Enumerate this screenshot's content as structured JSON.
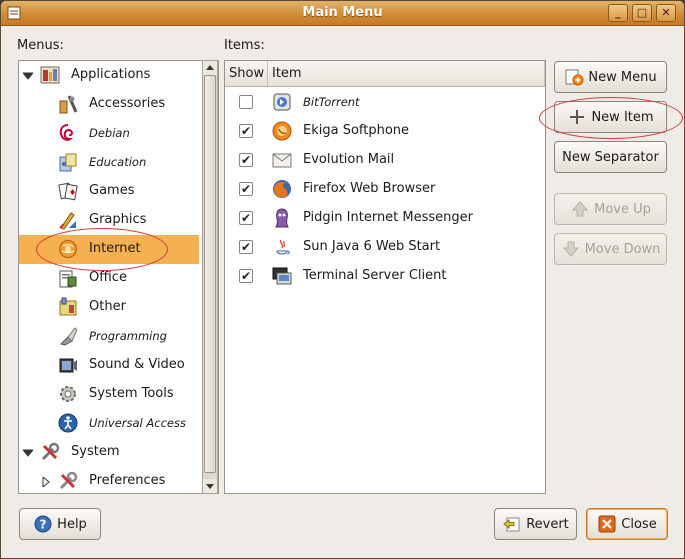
{
  "window": {
    "title": "Main Menu"
  },
  "labels": {
    "menus": "Menus:",
    "items": "Items:"
  },
  "menus": [
    {
      "label": "Applications",
      "level": 0,
      "expander": "expanded",
      "icon": "applications-icon",
      "italic": false,
      "selected": false
    },
    {
      "label": "Accessories",
      "level": 1,
      "icon": "accessories-icon",
      "italic": false,
      "selected": false
    },
    {
      "label": "Debian",
      "level": 1,
      "icon": "debian-icon",
      "italic": true,
      "selected": false
    },
    {
      "label": "Education",
      "level": 1,
      "icon": "education-icon",
      "italic": true,
      "selected": false
    },
    {
      "label": "Games",
      "level": 1,
      "icon": "games-icon",
      "italic": false,
      "selected": false
    },
    {
      "label": "Graphics",
      "level": 1,
      "icon": "graphics-icon",
      "italic": false,
      "selected": false
    },
    {
      "label": "Internet",
      "level": 1,
      "icon": "internet-icon",
      "italic": false,
      "selected": true
    },
    {
      "label": "Office",
      "level": 1,
      "icon": "office-icon",
      "italic": false,
      "selected": false
    },
    {
      "label": "Other",
      "level": 1,
      "icon": "other-icon",
      "italic": false,
      "selected": false
    },
    {
      "label": "Programming",
      "level": 1,
      "icon": "programming-icon",
      "italic": true,
      "selected": false
    },
    {
      "label": "Sound & Video",
      "level": 1,
      "icon": "sound-video-icon",
      "italic": false,
      "selected": false
    },
    {
      "label": "System Tools",
      "level": 1,
      "icon": "system-tools-icon",
      "italic": false,
      "selected": false
    },
    {
      "label": "Universal Access",
      "level": 1,
      "icon": "universal-access-icon",
      "italic": true,
      "selected": false
    },
    {
      "label": "System",
      "level": 0,
      "expander": "expanded",
      "icon": "system-icon",
      "italic": false,
      "selected": false
    },
    {
      "label": "Preferences",
      "level": 1,
      "expander": "collapsed",
      "icon": "preferences-icon",
      "italic": false,
      "selected": false
    }
  ],
  "items_table": {
    "columns": [
      "Show",
      "Item"
    ],
    "rows": [
      {
        "show": false,
        "label": "BitTorrent",
        "italic": true,
        "icon": "bittorrent-icon"
      },
      {
        "show": true,
        "label": "Ekiga Softphone",
        "italic": false,
        "icon": "ekiga-icon"
      },
      {
        "show": true,
        "label": "Evolution Mail",
        "italic": false,
        "icon": "mail-icon"
      },
      {
        "show": true,
        "label": "Firefox Web Browser",
        "italic": false,
        "icon": "firefox-icon"
      },
      {
        "show": true,
        "label": "Pidgin Internet Messenger",
        "italic": false,
        "icon": "pidgin-icon"
      },
      {
        "show": true,
        "label": "Sun Java 6 Web Start",
        "italic": false,
        "icon": "java-icon"
      },
      {
        "show": true,
        "label": "Terminal Server Client",
        "italic": false,
        "icon": "terminal-server-icon"
      }
    ]
  },
  "buttons": {
    "new_menu": "New Menu",
    "new_item": "New Item",
    "new_separator": "New Separator",
    "move_up": "Move Up",
    "move_down": "Move Down",
    "help": "Help",
    "revert": "Revert",
    "close": "Close"
  },
  "colors": {
    "titlebar": "#d08c37",
    "selection": "#f5b04f",
    "annotation_circle": "#d23a3a"
  }
}
